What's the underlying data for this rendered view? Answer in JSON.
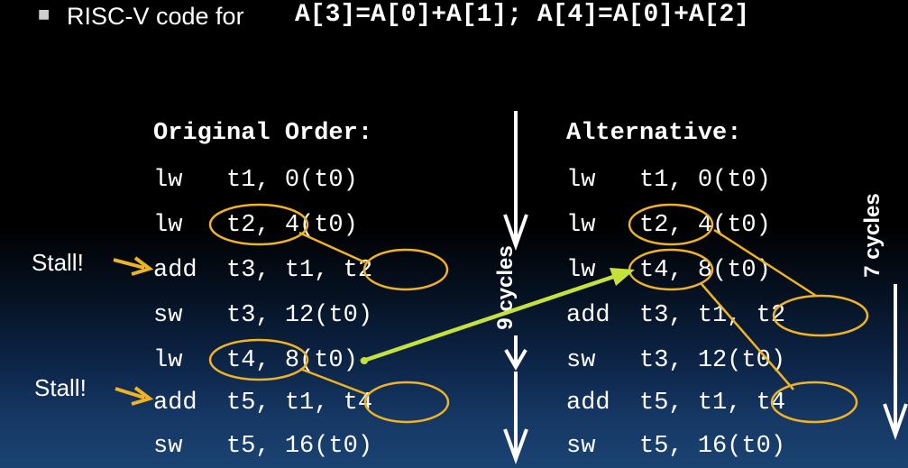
{
  "title": {
    "prefix": "RISC-V code for ",
    "code": "A[3]=A[0]+A[1]; A[4]=A[0]+A[2]"
  },
  "original": {
    "heading": "Original Order:",
    "lines": [
      "lw   t1, 0(t0)",
      "lw   t2, 4(t0)",
      "add  t3, t1, t2",
      "sw   t3, 12(t0)",
      "lw   t4, 8(t0)",
      "add  t5, t1, t4",
      "sw   t5, 16(t0)"
    ],
    "stalls": [
      "Stall!",
      "Stall!"
    ],
    "cycles_label": "9 cycles"
  },
  "alternative": {
    "heading": "Alternative:",
    "lines": [
      "lw   t1, 0(t0)",
      "lw   t2, 4(t0)",
      "lw   t4, 8(t0)",
      "add  t3, t1, t2",
      "sw   t3, 12(t0)",
      "add  t5, t1, t4",
      "sw   t5, 16(t0)"
    ],
    "cycles_label": "7 cycles"
  },
  "colors": {
    "highlight": "#f0b323",
    "move_arrow": "#c6e23a",
    "text": "#ffffff"
  }
}
